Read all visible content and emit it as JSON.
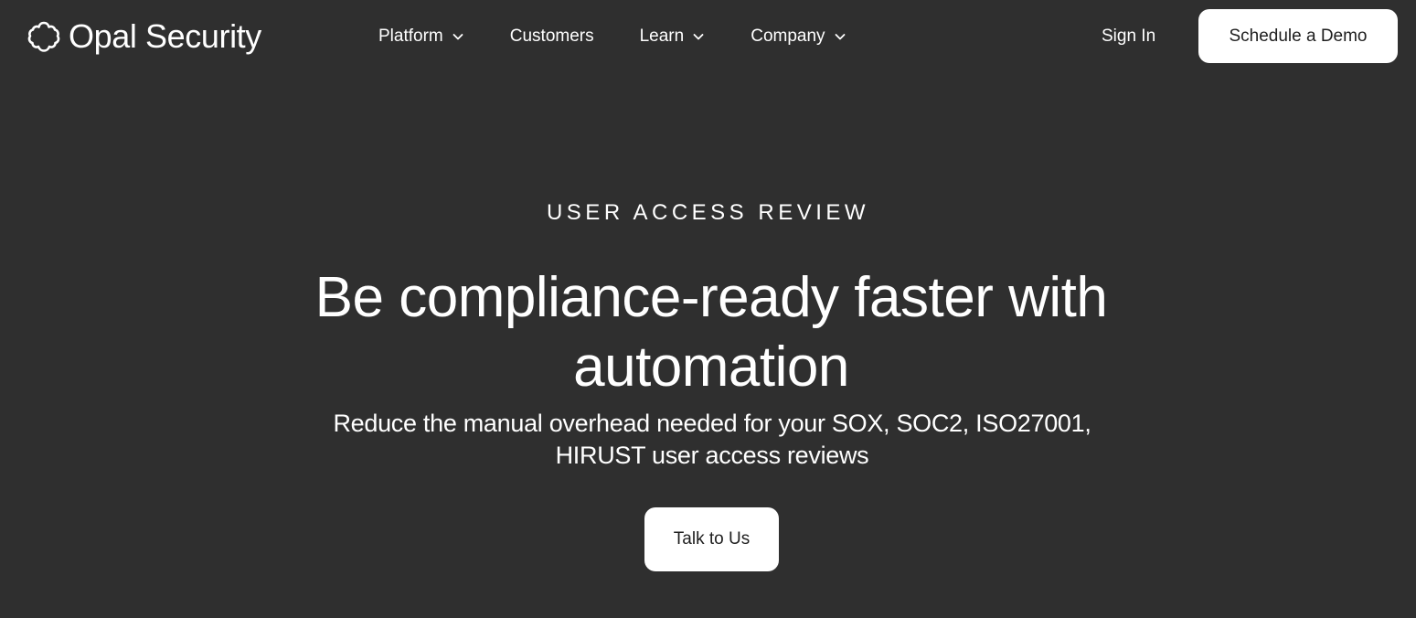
{
  "brand": {
    "name": "Opal Security",
    "logo_icon": "opal-cloud-icon"
  },
  "nav": {
    "items": [
      {
        "label": "Platform",
        "has_dropdown": true
      },
      {
        "label": "Customers",
        "has_dropdown": false
      },
      {
        "label": "Learn",
        "has_dropdown": true
      },
      {
        "label": "Company",
        "has_dropdown": true
      }
    ],
    "sign_in": "Sign In",
    "cta": "Schedule a Demo"
  },
  "hero": {
    "eyebrow": "USER ACCESS REVIEW",
    "headline": "Be compliance-ready faster with automation",
    "subtext": "Reduce the manual overhead needed for your SOX, SOC2, ISO27001, HIRUST user access reviews",
    "cta": "Talk to Us"
  },
  "colors": {
    "background": "#2f2f2f",
    "text": "#ffffff",
    "button_bg": "#ffffff",
    "button_text": "#1f1f1f"
  }
}
